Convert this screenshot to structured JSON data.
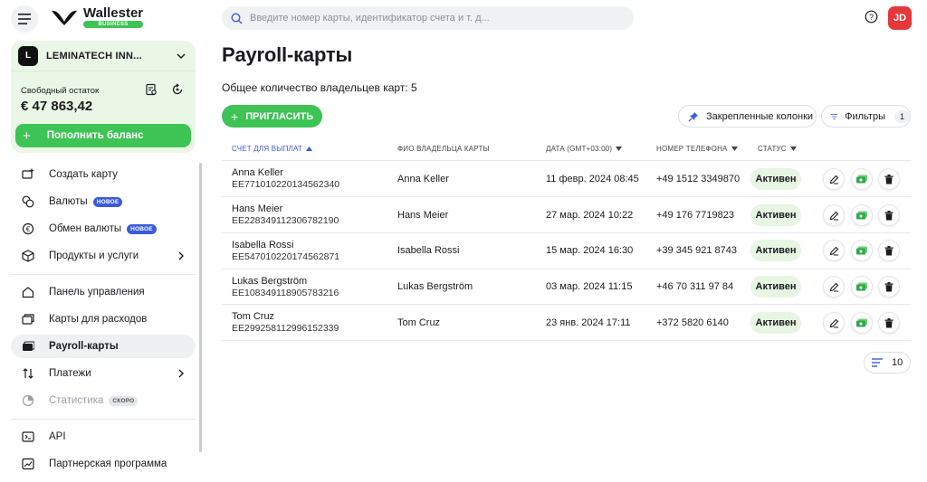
{
  "brand": {
    "name": "Wallester",
    "badge": "BUSINESS"
  },
  "search": {
    "placeholder": "Введите номер карты, идентификатор счета и т. д..."
  },
  "user": {
    "initials": "JD"
  },
  "account": {
    "initial": "L",
    "name": "LEMINATECH INN...",
    "balance_label": "Свободный остаток",
    "balance_value": "€ 47 863,42",
    "topup_label": "Пополнить баланс"
  },
  "sidebar": {
    "items": [
      {
        "label": "Создать карту"
      },
      {
        "label": "Валюты",
        "pill": "НОВОЕ"
      },
      {
        "label": "Обмен валюты",
        "pill": "НОВОЕ"
      },
      {
        "label": "Продукты и услуги"
      },
      {
        "label": "Панель управления"
      },
      {
        "label": "Карты для расходов"
      },
      {
        "label": "Payroll-карты"
      },
      {
        "label": "Платежи"
      },
      {
        "label": "Статистика",
        "pill": "СКОРО"
      },
      {
        "label": "API"
      },
      {
        "label": "Партнерская программа"
      }
    ]
  },
  "main": {
    "title": "Payroll-карты",
    "owners_count": "Общее количество владельцев карт: 5",
    "invite_label": "ПРИГЛАСИТЬ",
    "pinned_label": "Закрепленные колонки",
    "filters_label": "Фильтры",
    "filters_count": "1",
    "page_size": "10"
  },
  "table": {
    "headers": {
      "account": "СЧЕТ ДЛЯ ВЫПЛАТ",
      "owner": "ФИО ВЛАДЕЛЬЦА КАРТЫ",
      "date": "ДАТА (GMT+03:00)",
      "phone": "НОМЕР ТЕЛЕФОНА",
      "status": "СТАТУС"
    },
    "rows": [
      {
        "name": "Anna Keller",
        "iban": "EE771010220134562340",
        "owner": "Anna Keller",
        "date": "11 февр. 2024 08:45",
        "phone": "+49 1512 3349870",
        "status": "Активен"
      },
      {
        "name": "Hans Meier",
        "iban": "EE228349112306782190",
        "owner": "Hans Meier",
        "date": "27 мар. 2024 10:22",
        "phone": "+49 176 7719823",
        "status": "Активен"
      },
      {
        "name": "Isabella Rossi",
        "iban": "EE547010220174562871",
        "owner": "Isabella Rossi",
        "date": "15 мар. 2024 16:30",
        "phone": "+39 345 921 8743",
        "status": "Активен"
      },
      {
        "name": "Lukas Bergström",
        "iban": "EE108349118905783216",
        "owner": "Lukas Bergström",
        "date": "03 мар. 2024 11:15",
        "phone": "+46 70 311 97 84",
        "status": "Активен"
      },
      {
        "name": "Tom Cruz",
        "iban": "EE299258112996152339",
        "owner": "Tom Cruz",
        "date": "23 янв. 2024 17:11",
        "phone": "+372 5820 6140",
        "status": "Активен"
      }
    ]
  },
  "colors": {
    "accent_green": "#3ec355",
    "status_bg": "#e7f6e3",
    "pill_blue": "#3b5bdb",
    "avatar_red": "#e5383b"
  }
}
